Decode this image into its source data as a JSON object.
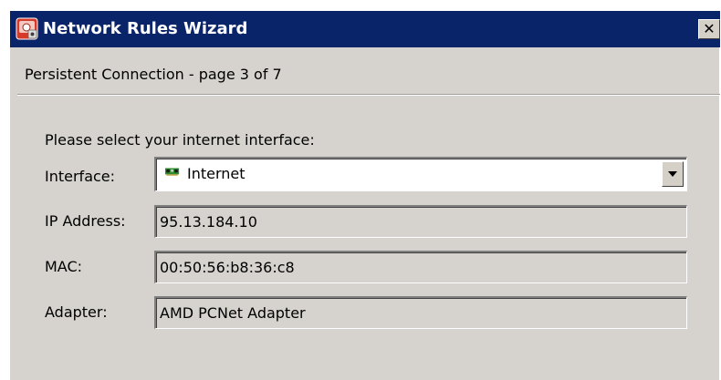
{
  "window": {
    "title": "Network Rules Wizard",
    "close_label": "✕"
  },
  "page": {
    "label": "Persistent Connection - page 3 of 7"
  },
  "form": {
    "prompt": "Please select your internet interface:",
    "interface": {
      "label": "Interface:",
      "value": "Internet",
      "icon": "network-card-icon"
    },
    "ip_address": {
      "label": "IP Address:",
      "value": "95.13.184.10"
    },
    "mac": {
      "label": "MAC:",
      "value": "00:50:56:b8:36:c8"
    },
    "adapter": {
      "label": "Adapter:",
      "value": "AMD PCNet Adapter"
    }
  },
  "colors": {
    "titlebar": "#0a246a",
    "dialog_bg": "#d6d3ce"
  }
}
